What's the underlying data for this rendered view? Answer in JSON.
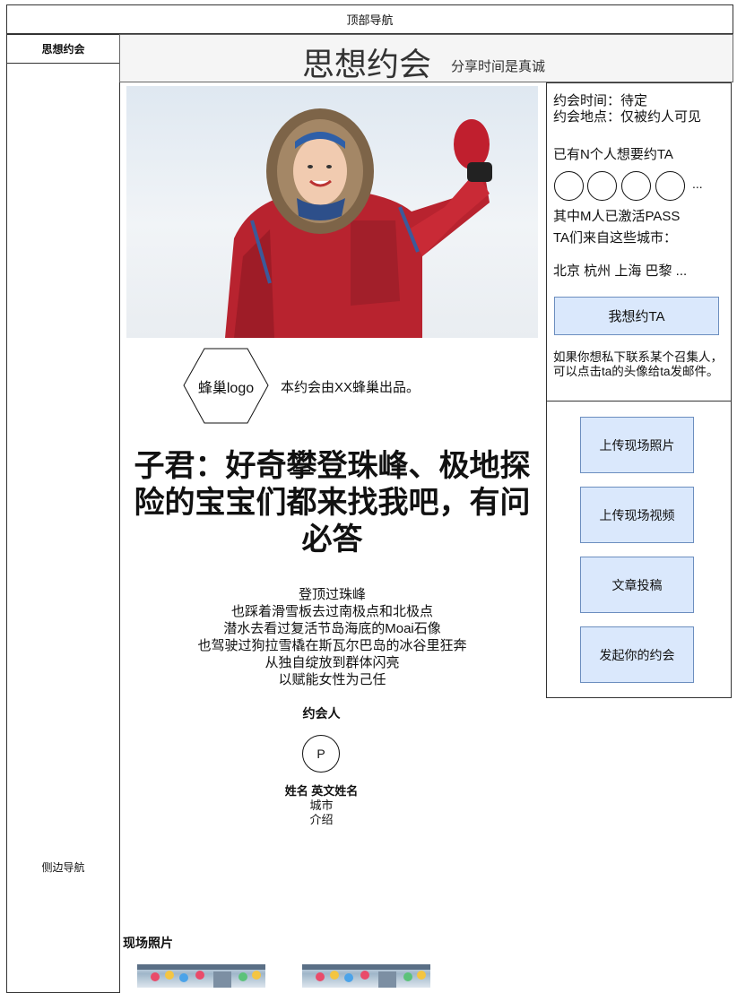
{
  "top_nav": {
    "label": "顶部导航"
  },
  "side_nav": {
    "brand": "思想约会",
    "label": "侧边导航"
  },
  "header": {
    "title": "思想约会",
    "subtitle": "分享时间是真诚"
  },
  "info": {
    "time": "约会时间：待定",
    "place": "约会地点：仅被约人可见",
    "want_count": "已有N个人想要约TA",
    "more": "...",
    "activated": "其中M人已激活PASS",
    "cities_intro": "TA们来自这些城市：",
    "cities": "北京 杭州 上海 巴黎 ...",
    "cta": "我想约TA",
    "note": "如果你想私下联系某个召集人，可以点击ta的头像给ta发邮件。"
  },
  "actions": {
    "upload_photo": "上传现场照片",
    "upload_video": "上传现场视频",
    "submit_article": "文章投稿",
    "start_date": "发起你的约会"
  },
  "hive": {
    "logo": "蜂巢logo",
    "text": "本约会由XX蜂巢出品。"
  },
  "article": {
    "title": "子君：好奇攀登珠峰、极地探险的宝宝们都来找我吧，有问必答",
    "lines": [
      "登顶过珠峰",
      "也踩着滑雪板去过南极点和北极点",
      "潜水去看过复活节岛海底的Moai石像",
      "也驾驶过狗拉雪橇在斯瓦尔巴岛的冰谷里狂奔",
      "从独自绽放到群体闪亮",
      "以赋能女性为己任"
    ]
  },
  "host": {
    "section_title": "约会人",
    "avatar_letter": "P",
    "name": "姓名 英文姓名",
    "city": "城市",
    "intro": "介绍"
  },
  "photos": {
    "section_title": "现场照片"
  }
}
